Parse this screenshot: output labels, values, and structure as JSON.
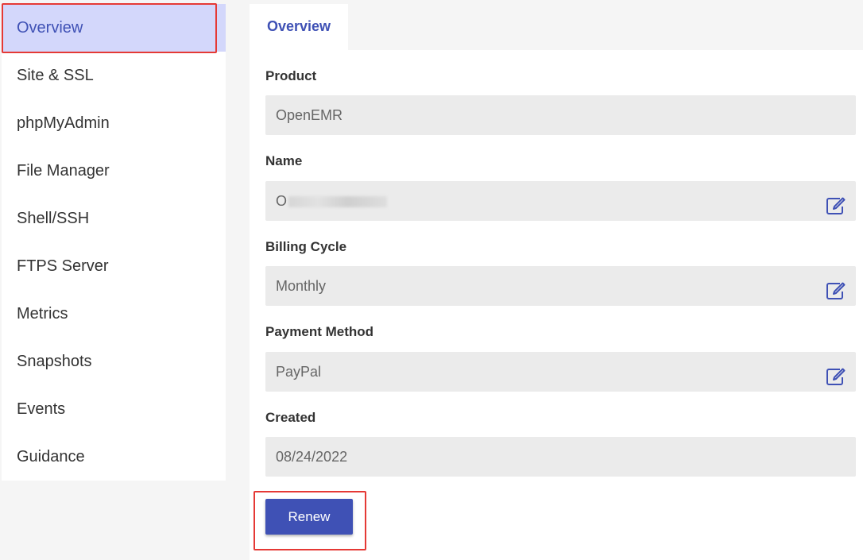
{
  "sidebar": {
    "items": [
      {
        "label": "Overview",
        "active": true
      },
      {
        "label": "Site & SSL"
      },
      {
        "label": "phpMyAdmin"
      },
      {
        "label": "File Manager"
      },
      {
        "label": "Shell/SSH"
      },
      {
        "label": "FTPS Server"
      },
      {
        "label": "Metrics"
      },
      {
        "label": "Snapshots"
      },
      {
        "label": "Events"
      },
      {
        "label": "Guidance"
      }
    ]
  },
  "tabs": [
    {
      "label": "Overview",
      "active": true
    }
  ],
  "fields": {
    "product": {
      "label": "Product",
      "value": "OpenEMR"
    },
    "name": {
      "label": "Name",
      "value": "O",
      "edit_icon": "edit-icon"
    },
    "billing_cycle": {
      "label": "Billing Cycle",
      "value": "Monthly",
      "edit_icon": "edit-icon"
    },
    "payment_method": {
      "label": "Payment Method",
      "value": "PayPal",
      "edit_icon": "edit-icon"
    },
    "created": {
      "label": "Created",
      "value": "08/24/2022"
    }
  },
  "actions": {
    "renew_label": "Renew"
  },
  "colors": {
    "accent": "#3f51b5",
    "active_bg": "#d3d7fb",
    "field_bg": "#ebebeb",
    "highlight": "#e53935"
  }
}
